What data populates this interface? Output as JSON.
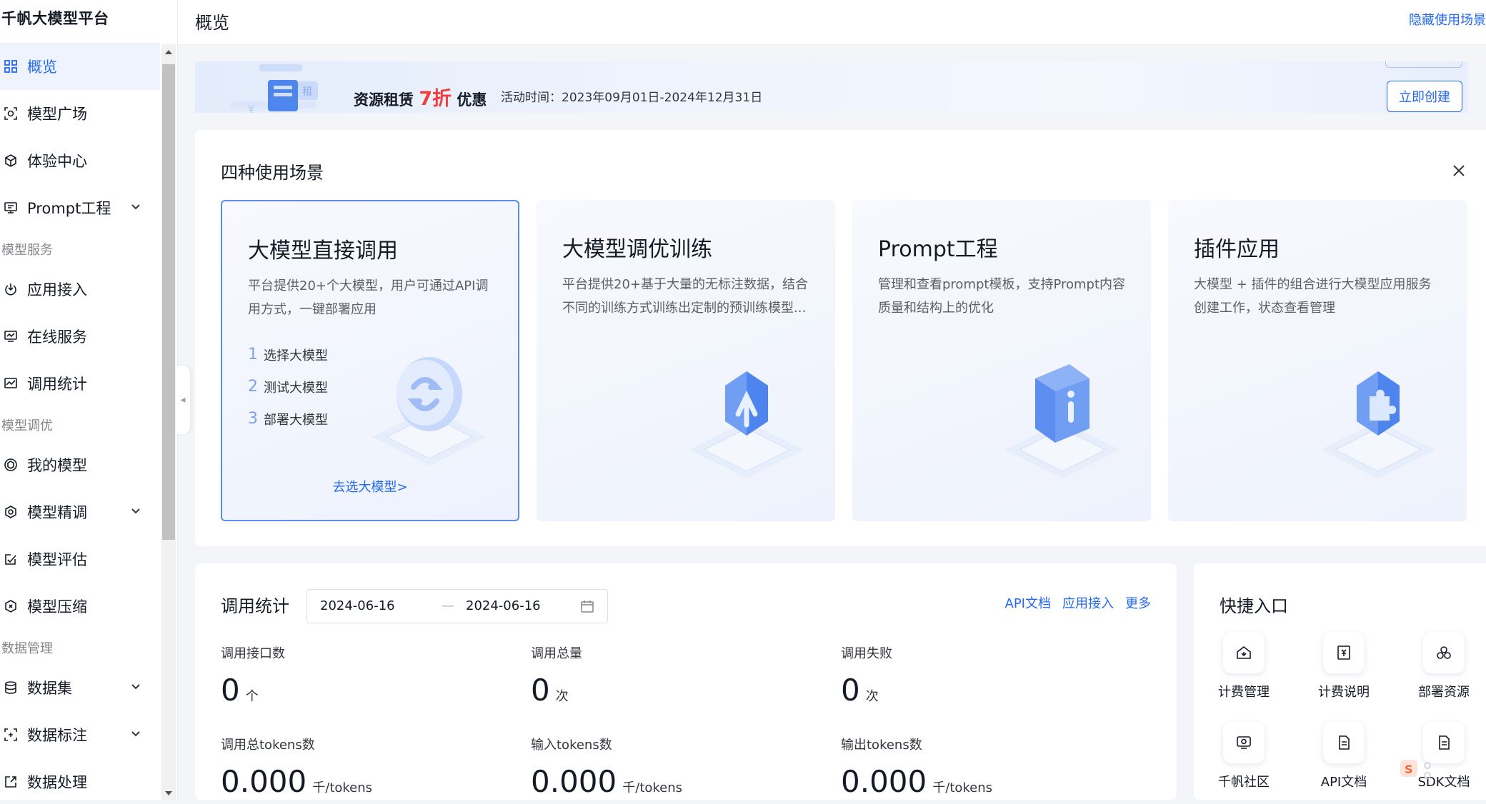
{
  "brand": "千帆大模型平台",
  "sidebar": {
    "items": [
      {
        "label": "概览",
        "icon": "overview-grid-icon",
        "active": true
      },
      {
        "label": "模型广场",
        "icon": "model-plaza-icon"
      },
      {
        "label": "体验中心",
        "icon": "experience-cube-icon"
      },
      {
        "label": "Prompt工程",
        "icon": "prompt-icon",
        "expandable": true
      }
    ],
    "sections": [
      {
        "title": "模型服务",
        "items": [
          {
            "label": "应用接入",
            "icon": "app-access-icon"
          },
          {
            "label": "在线服务",
            "icon": "online-service-icon"
          },
          {
            "label": "调用统计",
            "icon": "call-stats-icon"
          }
        ]
      },
      {
        "title": "模型调优",
        "items": [
          {
            "label": "我的模型",
            "icon": "my-model-icon"
          },
          {
            "label": "模型精调",
            "icon": "fine-tune-icon",
            "expandable": true
          },
          {
            "label": "模型评估",
            "icon": "evaluate-icon"
          },
          {
            "label": "模型压缩",
            "icon": "compress-icon"
          }
        ]
      },
      {
        "title": "数据管理",
        "items": [
          {
            "label": "数据集",
            "icon": "dataset-icon",
            "expandable": true
          },
          {
            "label": "数据标注",
            "icon": "annotation-icon",
            "expandable": true
          },
          {
            "label": "数据处理",
            "icon": "data-process-icon"
          }
        ]
      }
    ]
  },
  "header": {
    "title": "概览",
    "hide_scene_link": "隐藏使用场景"
  },
  "banner": {
    "title_prefix": "资源租赁",
    "discount": "7折",
    "title_suffix": "优惠",
    "art_char": "租",
    "time": "活动时间：2023年09月01日-2024年12月31日",
    "button": "立即创建"
  },
  "scenes": {
    "title": "四种使用场景",
    "cards": [
      {
        "title": "大模型直接调用",
        "desc": "平台提供20+个大模型，用户可通过API调用方式，一键部署应用",
        "steps": [
          {
            "num": "1",
            "label": "选择大模型"
          },
          {
            "num": "2",
            "label": "测试大模型"
          },
          {
            "num": "3",
            "label": "部署大模型"
          }
        ],
        "link": "去选大模型>",
        "illustration": "sync-arrows-icon"
      },
      {
        "title": "大模型调优训练",
        "desc": "平台提供20+基于大量的无标注数据，结合不同的训练方式训练出定制的预训练模型...",
        "illustration": "upload-arrow-icon"
      },
      {
        "title": "Prompt工程",
        "desc": "管理和查看prompt模板，支持Prompt内容质量和结构上的优化",
        "illustration": "info-icon"
      },
      {
        "title": "插件应用",
        "desc": "大模型 + 插件的组合进行大模型应用服务创建工作，状态查看管理",
        "illustration": "puzzle-icon"
      }
    ]
  },
  "stats": {
    "title": "调用统计",
    "date_start": "2024-06-16",
    "date_sep": "—",
    "date_end": "2024-06-16",
    "links": [
      "API文档",
      "应用接入",
      "更多"
    ],
    "metrics": [
      {
        "label": "调用接口数",
        "value": "0",
        "unit": "个"
      },
      {
        "label": "调用总量",
        "value": "0",
        "unit": "次"
      },
      {
        "label": "调用失败",
        "value": "0",
        "unit": "次"
      },
      {
        "label": "调用总tokens数",
        "value": "0.000",
        "unit": "千/tokens"
      },
      {
        "label": "输入tokens数",
        "value": "0.000",
        "unit": "千/tokens"
      },
      {
        "label": "输出tokens数",
        "value": "0.000",
        "unit": "千/tokens"
      }
    ]
  },
  "quick": {
    "title": "快捷入口",
    "items": [
      {
        "label": "计费管理",
        "icon": "billing-manage-icon"
      },
      {
        "label": "计费说明",
        "icon": "billing-doc-icon"
      },
      {
        "label": "部署资源",
        "icon": "deploy-resource-icon"
      },
      {
        "label": "千帆社区",
        "icon": "community-icon"
      },
      {
        "label": "API文档",
        "icon": "api-doc-icon"
      },
      {
        "label": "SDK文档",
        "icon": "sdk-doc-icon"
      }
    ]
  },
  "colors": {
    "accent": "#2468f2",
    "discount": "#f03e3e",
    "active_bg": "#eef3fe"
  }
}
